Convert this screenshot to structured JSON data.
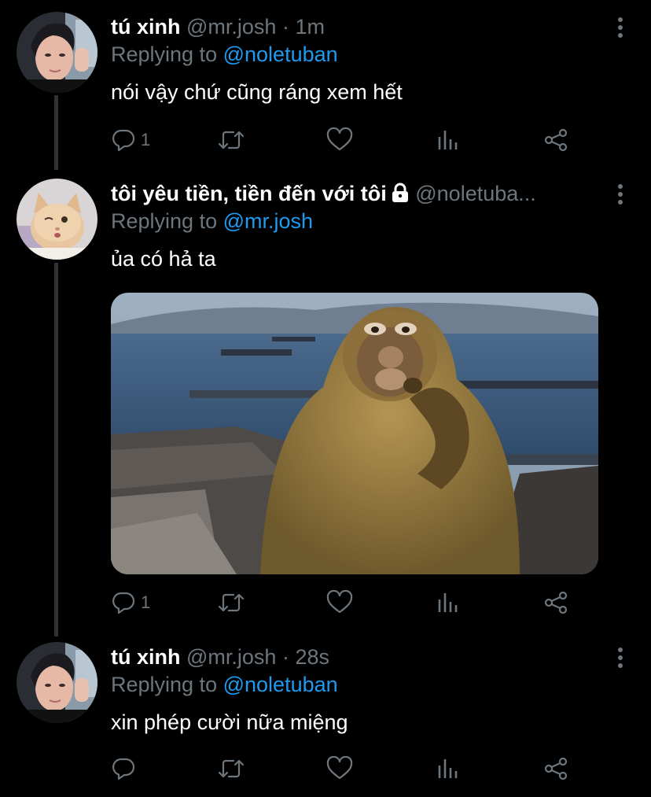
{
  "tweets": [
    {
      "display_name": "tú xinh",
      "handle": "@mr.josh",
      "separator": "·",
      "time": "1m",
      "replying_prefix": "Replying to",
      "replying_to": "@noletuban",
      "text": "nói vậy chứ cũng ráng xem hết",
      "reply_count": "1",
      "protected": false
    },
    {
      "display_name": "tôi yêu tiền, tiền đến với tôi",
      "handle": "@noletuba...",
      "replying_prefix": "Replying to",
      "replying_to": "@mr.josh",
      "text": "ủa có hả ta",
      "reply_count": "1",
      "protected": true,
      "has_media": true
    },
    {
      "display_name": "tú xinh",
      "handle": "@mr.josh",
      "separator": "·",
      "time": "28s",
      "replying_prefix": "Replying to",
      "replying_to": "@noletuban",
      "text": "xin phép cười nữa miệng",
      "reply_count": "",
      "protected": false
    }
  ],
  "icons": {
    "reply": "reply-icon",
    "retweet": "retweet-icon",
    "like": "heart-icon",
    "stats": "analytics-icon",
    "share": "share-icon",
    "more": "more-vertical-icon",
    "lock": "lock-icon"
  },
  "colors": {
    "background": "#000000",
    "primary_text": "#ffffff",
    "secondary_text": "#6e767d",
    "link": "#1d9bf0",
    "thread_line": "#2f3336"
  }
}
